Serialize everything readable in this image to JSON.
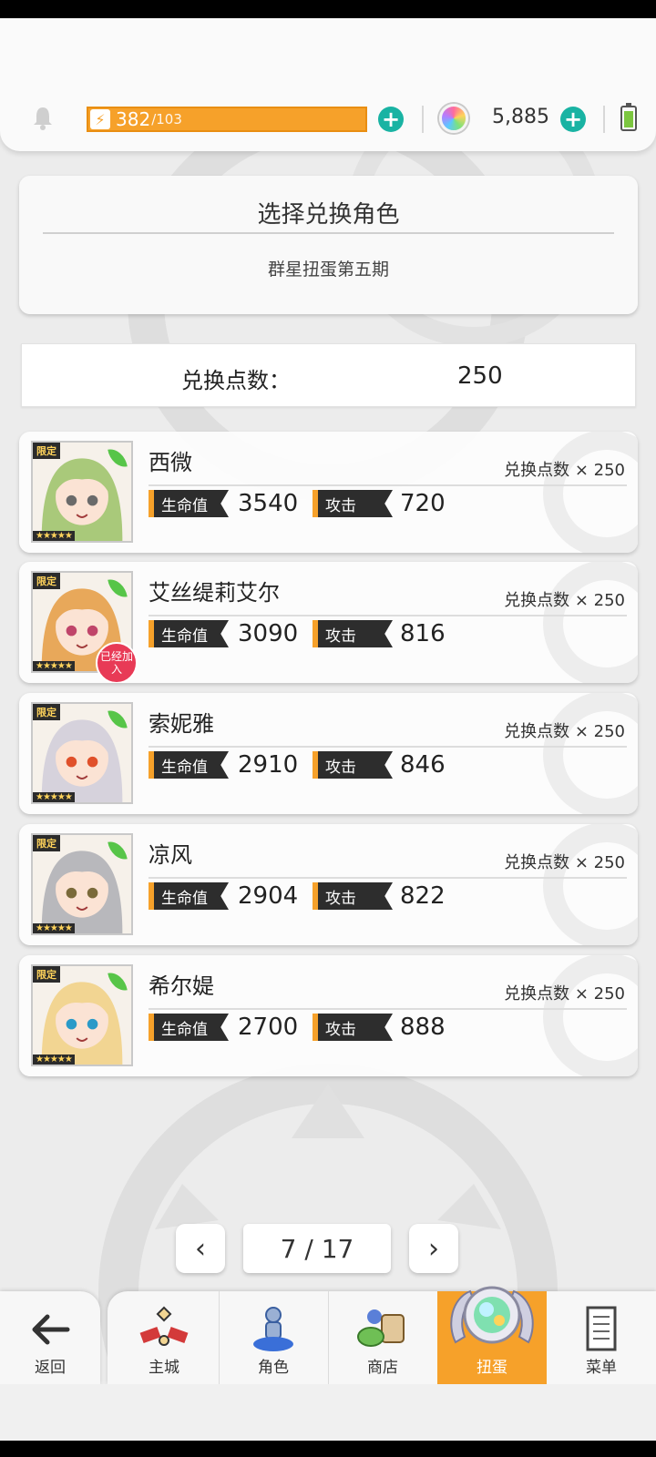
{
  "top_bar": {
    "stamina_current": "382",
    "stamina_max": "/103",
    "gem_count": "5,885"
  },
  "header": {
    "title": "选择兑换角色",
    "subtitle": "群星扭蛋第五期"
  },
  "points": {
    "label": "兑换点数：",
    "value": "250"
  },
  "labels": {
    "limited": "限定",
    "stars": "★★★★★",
    "joined": "已经加入",
    "hp": "生命值",
    "atk": "攻击"
  },
  "characters": [
    {
      "name": "西微",
      "cost": "兑换点数 × 250",
      "hp": "3540",
      "atk": "720",
      "joined": false,
      "hair": "#a9c97a",
      "eye": "#6a6a6a"
    },
    {
      "name": "艾丝缇莉艾尔",
      "cost": "兑换点数 × 250",
      "hp": "3090",
      "atk": "816",
      "joined": true,
      "hair": "#e8a85a",
      "eye": "#c0456a"
    },
    {
      "name": "索妮雅",
      "cost": "兑换点数 × 250",
      "hp": "2910",
      "atk": "846",
      "joined": false,
      "hair": "#d6d2dc",
      "eye": "#e0502a"
    },
    {
      "name": "凉风",
      "cost": "兑换点数 × 250",
      "hp": "2904",
      "atk": "822",
      "joined": false,
      "hair": "#b8b8bc",
      "eye": "#7a6a3a"
    },
    {
      "name": "希尔媞",
      "cost": "兑换点数 × 250",
      "hp": "2700",
      "atk": "888",
      "joined": false,
      "hair": "#f2d592",
      "eye": "#2a9ac8"
    }
  ],
  "pagination": {
    "indicator": "7 / 17",
    "prev": "‹",
    "next": "›"
  },
  "nav": {
    "back": "返回",
    "items": [
      "主城",
      "角色",
      "商店",
      "扭蛋",
      "菜单"
    ],
    "active": "扭蛋"
  },
  "colors": {
    "accent": "#f6a12a",
    "plus": "#19b3a3",
    "joined_badge": "#e83a56"
  }
}
